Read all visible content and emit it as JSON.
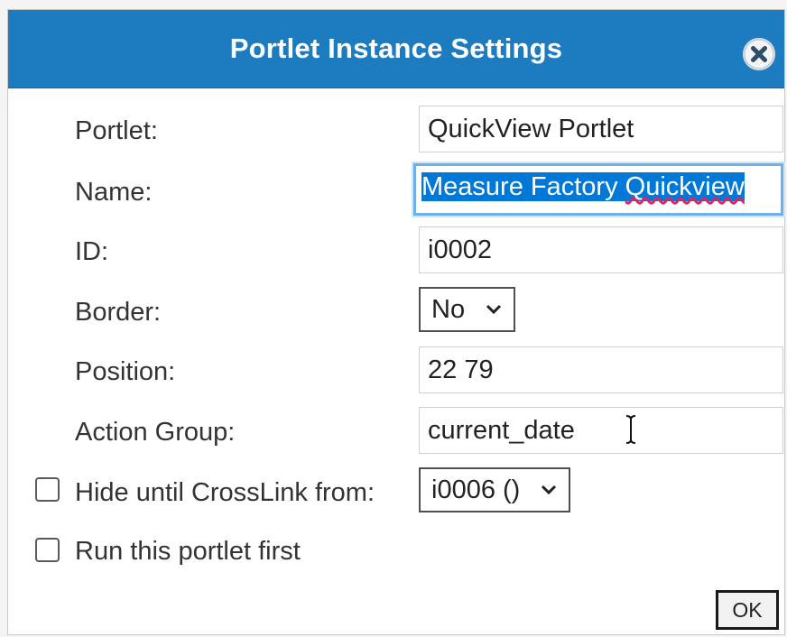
{
  "dialog": {
    "title": "Portlet Instance Settings",
    "close_icon": "close-circle-icon"
  },
  "fields": {
    "portlet_label": "Portlet:",
    "portlet_value": "QuickView Portlet",
    "name_label": "Name:",
    "name_value_part1": "Measure Factory ",
    "name_value_part2": "Quickview",
    "id_label": "ID:",
    "id_value": "i0002",
    "border_label": "Border:",
    "border_selected": "No",
    "position_label": "Position:",
    "position_value": "22 79",
    "action_group_label": "Action Group:",
    "action_group_value": "current_date"
  },
  "options": {
    "hide_label": "Hide until CrossLink from:",
    "hide_checked": false,
    "crosslink_selected": "i0006 ()",
    "run_first_label": "Run this portlet first",
    "run_first_checked": false
  },
  "buttons": {
    "ok_label": "OK"
  },
  "colors": {
    "titlebar": "#1d7bbf",
    "selection": "#0078d7",
    "focus_ring": "#6fb0e6"
  },
  "icons": {
    "text_cursor": "i-beam-cursor-icon",
    "dropdown": "chevron-down-icon"
  }
}
